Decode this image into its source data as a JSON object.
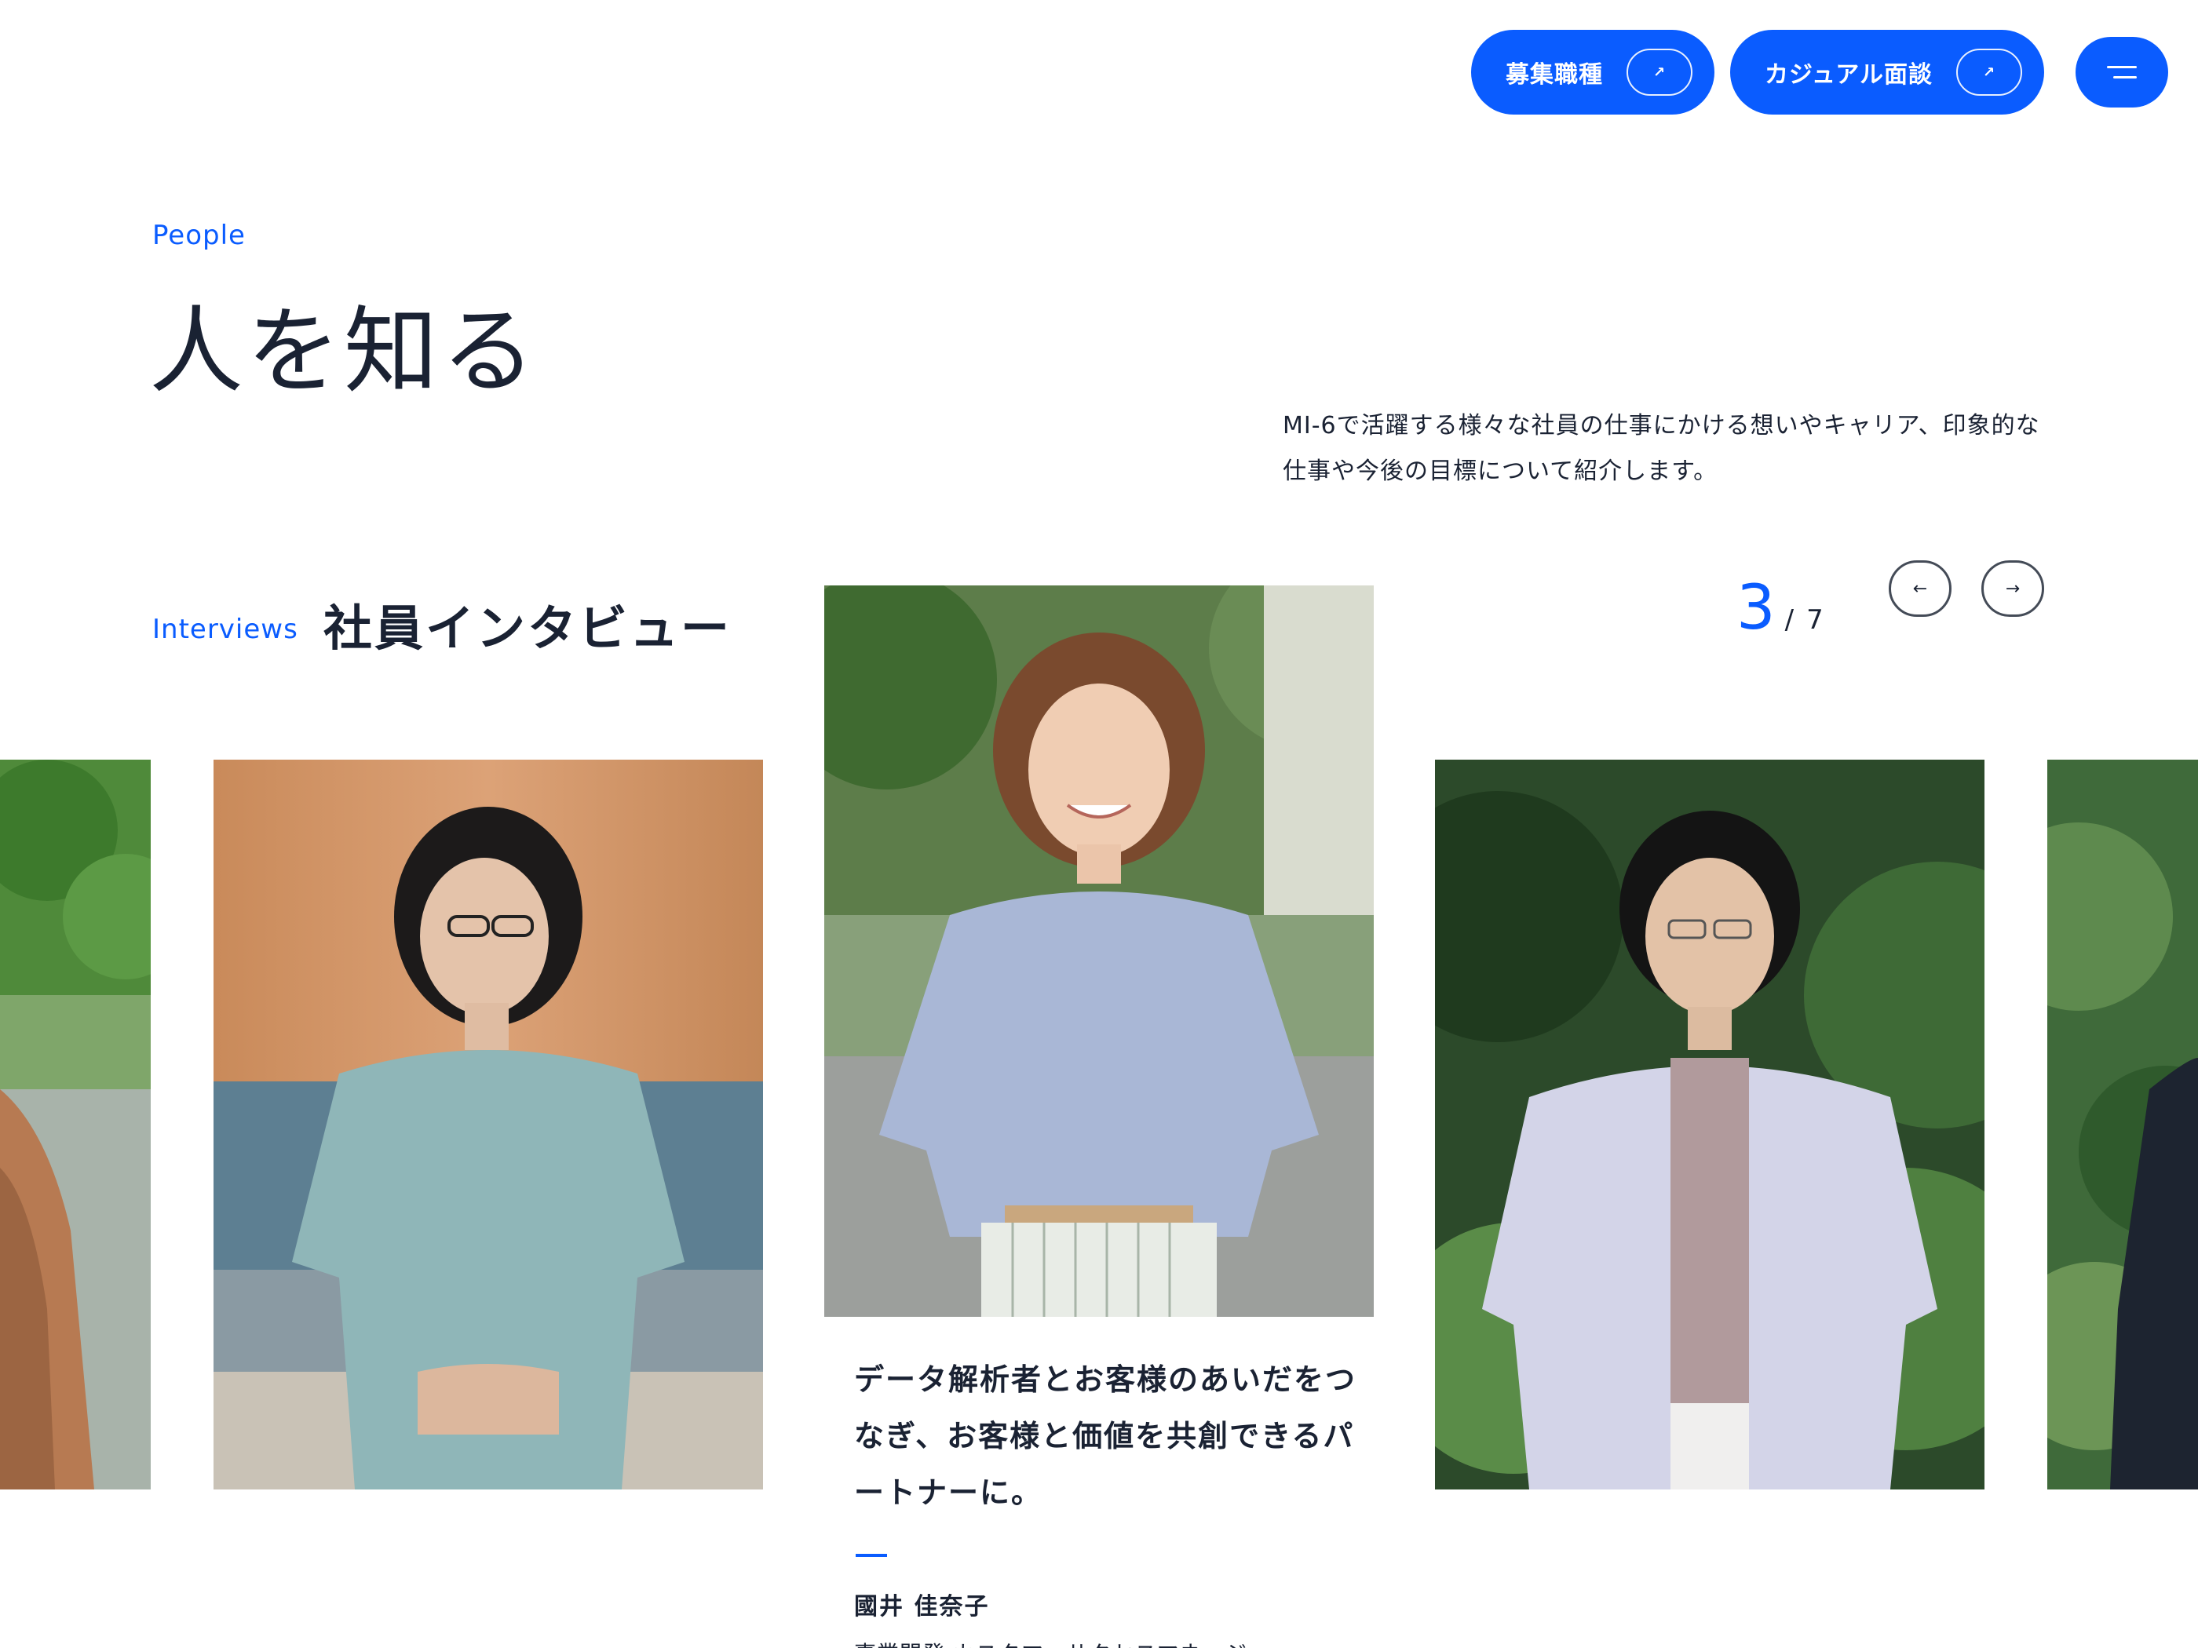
{
  "header": {
    "jobs_label": "募集職種",
    "casual_label": "カジュアル面談"
  },
  "hero": {
    "eyebrow": "People",
    "title": "人を知る",
    "intro": "MI-6で活躍する様々な社員の仕事にかける想いやキャリア、印象的な仕事や今後の目標について紹介します。"
  },
  "interviews": {
    "eyebrow": "Interviews",
    "title": "社員インタビュー",
    "current": "3",
    "separator": "/",
    "total": "7",
    "prev_arrow": "←",
    "next_arrow": "→",
    "active_card": {
      "quote": "データ解析者とお客様のあいだをつなぎ、お客様と価値を共創できるパートナーに。",
      "name": "國井 佳奈子",
      "role": "事業開発 カスタマーサクセスマネージャー"
    }
  },
  "colors": {
    "accent": "#0a5cff",
    "text": "#1a2233"
  }
}
